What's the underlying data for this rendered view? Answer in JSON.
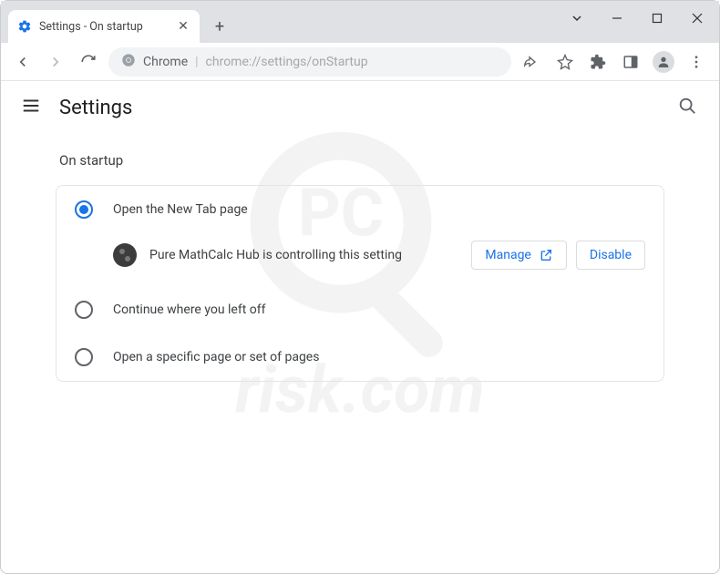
{
  "window": {
    "tab_title": "Settings - On startup"
  },
  "omnibox": {
    "host_label": "Chrome",
    "path": "chrome://settings/onStartup"
  },
  "settings": {
    "title": "Settings",
    "section_title": "On startup",
    "options": {
      "new_tab": "Open the New Tab page",
      "continue": "Continue where you left off",
      "specific": "Open a specific page or set of pages"
    },
    "extension_notice": "Pure MathCalc Hub is controlling this setting",
    "buttons": {
      "manage": "Manage",
      "disable": "Disable"
    },
    "selected_option": "new_tab"
  },
  "watermark_text": "risk.com"
}
